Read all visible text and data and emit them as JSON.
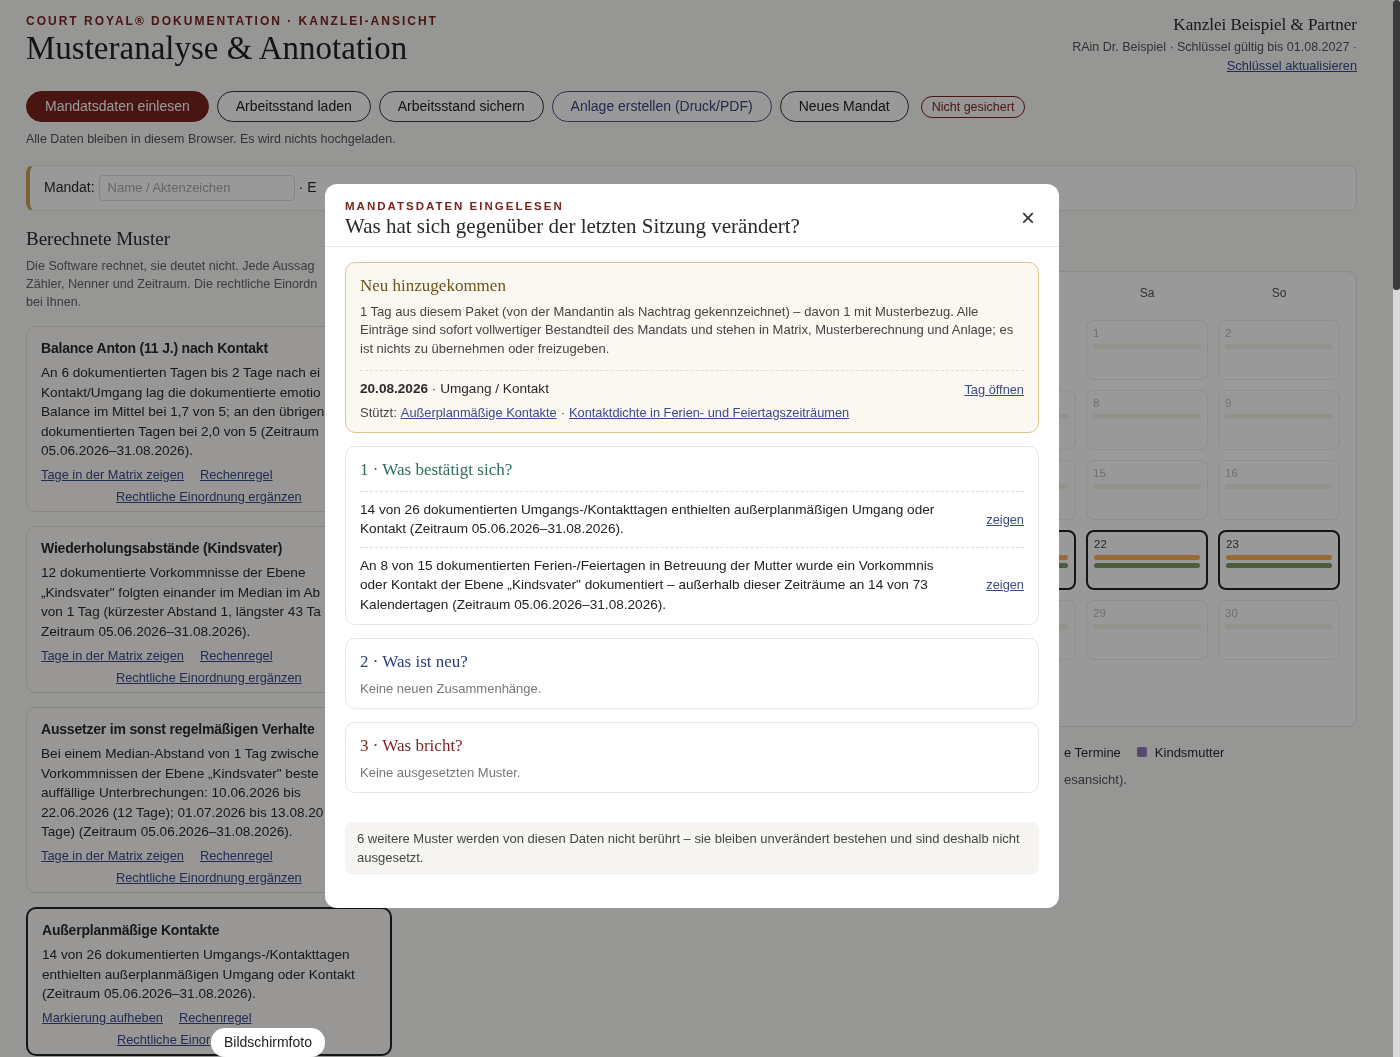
{
  "header": {
    "kicker": "COURT ROYAL® DOKUMENTATION · KANZLEI-ANSICHT",
    "title": "Musteranalyse & Annotation",
    "firm": "Kanzlei Beispiel & Partner",
    "license": "RAin Dr. Beispiel · Schlüssel gültig bis 01.08.2027 ·",
    "license_link": "Schlüssel aktualisieren"
  },
  "toolbar": {
    "buttons": [
      {
        "label": "Mandatsdaten einlesen",
        "kind": "primary"
      },
      {
        "label": "Arbeitsstand laden",
        "kind": "outline"
      },
      {
        "label": "Arbeitsstand sichern",
        "kind": "outline"
      },
      {
        "label": "Anlage erstellen (Druck/PDF)",
        "kind": "export"
      },
      {
        "label": "Neues Mandat",
        "kind": "outline"
      }
    ],
    "status": "Nicht gesichert",
    "note": "Alle Daten bleiben in diesem Browser. Es wird nichts hochgeladen."
  },
  "mandate_bar": {
    "label": "Mandat:",
    "placeholder": "Name / Aktenzeichen",
    "trailing": "· E"
  },
  "patterns": {
    "title": "Berechnete Muster",
    "intro_lines": [
      "Die Software rechnet, sie deutet nicht. Jede Aussag",
      "Zähler, Nenner und Zeitraum. Die rechtliche Einordn",
      "bei Ihnen."
    ],
    "cards": [
      {
        "title": "Balance Anton (11 J.) nach Kontakt",
        "selected": false,
        "lines": [
          "An 6 dokumentierten Tagen bis 2 Tage nach ei",
          "Kontakt/Umgang lag die dokumentierte emotio",
          "Balance im Mittel bei 1,7 von 5; an den übrigen",
          "dokumentierten Tagen bei 2,0 von 5 (Zeitraum",
          "05.06.2026–31.08.2026)."
        ],
        "links": [
          "Tage in der Matrix zeigen",
          "Rechenregel"
        ],
        "annotation_link": "Rechtliche Einordnung ergänzen"
      },
      {
        "title": "Wiederholungsabstände (Kindsvater)",
        "selected": false,
        "lines": [
          "12 dokumentierte Vorkommnisse der Ebene",
          "„Kindsvater\" folgten einander im Median im Ab",
          "von 1 Tag (kürzester Abstand 1, längster 43 Ta",
          "Zeitraum 05.06.2026–31.08.2026)."
        ],
        "links": [
          "Tage in der Matrix zeigen",
          "Rechenregel"
        ],
        "annotation_link": "Rechtliche Einordnung ergänzen"
      },
      {
        "title": "Aussetzer im sonst regelmäßigen Verhalte",
        "selected": false,
        "lines": [
          "Bei einem Median-Abstand von 1 Tag zwische",
          "Vorkommnissen der Ebene „Kindsvater\" beste",
          "auffällige Unterbrechungen: 10.06.2026 bis",
          "22.06.2026 (12 Tage); 01.07.2026 bis 13.08.20",
          "Tage) (Zeitraum 05.06.2026–31.08.2026)."
        ],
        "links": [
          "Tage in der Matrix zeigen",
          "Rechenregel"
        ],
        "annotation_link": "Rechtliche Einordnung ergänzen"
      },
      {
        "title": "Außerplanmäßige Kontakte",
        "selected": true,
        "lines": [
          "14 von 26 dokumentierten Umgangs-/Kontakttagen",
          "enthielten außerplanmäßigen Umgang oder Kontakt",
          "(Zeitraum 05.06.2026–31.08.2026)."
        ],
        "links": [
          "Markierung aufheben",
          "Rechenregel"
        ],
        "annotation_link": "Rechtliche Einor"
      }
    ]
  },
  "calendar": {
    "weekdays": [
      "Sa",
      "So"
    ],
    "rows": [
      {
        "cells": [
          null,
          {
            "day": "1",
            "highlighted": false,
            "bars": [
              {
                "color": "#8f938a"
              }
            ]
          },
          {
            "day": "2",
            "highlighted": false,
            "bars": [
              {
                "color": "#8f938a"
              }
            ]
          }
        ]
      },
      {
        "cells": [
          {
            "highlighted": false,
            "bars": [
              {
                "color": "#8f938a"
              }
            ]
          },
          {
            "day": "8",
            "highlighted": false,
            "bars": [
              {
                "color": "#8f938a"
              }
            ]
          },
          {
            "day": "9",
            "highlighted": false,
            "bars": [
              {
                "color": "#8f938a"
              }
            ]
          }
        ]
      },
      {
        "cells": [
          {
            "highlighted": false,
            "bars": [
              {
                "color": "#8f938a"
              }
            ]
          },
          {
            "day": "15",
            "highlighted": false,
            "bars": [
              {
                "color": "#8f938a"
              }
            ]
          },
          {
            "day": "16",
            "highlighted": false,
            "bars": [
              {
                "color": "#8f938a"
              }
            ]
          }
        ]
      },
      {
        "cells": [
          {
            "highlighted": true,
            "bars": [
              {
                "color": "#9a6a35"
              },
              {
                "color": "#4b5d3c"
              }
            ]
          },
          {
            "day": "22",
            "highlighted": true,
            "bars": [
              {
                "color": "#9a6a35"
              },
              {
                "color": "#4b5d3c"
              }
            ]
          },
          {
            "day": "23",
            "highlighted": true,
            "bars": [
              {
                "color": "#9a6a35"
              },
              {
                "color": "#4b5d3c"
              }
            ]
          }
        ]
      },
      {
        "cells": [
          {
            "highlighted": false,
            "bars": [
              {
                "color": "#8f938a"
              }
            ]
          },
          {
            "day": "29",
            "highlighted": false,
            "bars": [
              {
                "color": "#8f938a"
              }
            ]
          },
          {
            "day": "30",
            "highlighted": false,
            "bars": [
              {
                "color": "#8f938a"
              }
            ]
          }
        ]
      }
    ],
    "legend": [
      {
        "label": "e Termine"
      },
      {
        "label": "Kindsmutter",
        "color": "#574a70"
      }
    ],
    "note": "esansicht)."
  },
  "dialog": {
    "kicker": "MANDATSDATEN EINGELESEN",
    "close_label": "×",
    "title": "Was hat sich gegenüber der letzten Sitzung verändert?",
    "added": {
      "title": "Neu hinzugekommen",
      "text": "1 Tag aus diesem Paket (von der Mandantin als Nachtrag gekennzeichnet) – davon 1 mit Musterbezug. Alle Einträge sind sofort vollwertiger Bestandteil des Mandats und stehen in Matrix, Musterberechnung und Anlage; es ist nichts zu übernehmen oder freizugeben.",
      "entry": "**20.08.2026** · Umgang / Kontakt",
      "entry_link": "Tag öffnen",
      "supports_label": "Stützt:",
      "supports_separator": "·",
      "supports": [
        "Außerplanmäßige Kontakte",
        "Kontaktdichte in Ferien- und Feiertagszeiträumen"
      ]
    },
    "sections": [
      {
        "kind": "confirmed",
        "title": "1 · Was bestätigt sich?",
        "items": [
          {
            "text": "14 von 26 dokumentierten Umgangs-/Kontakttagen enthielten außerplanmäßigen Umgang oder Kontakt (Zeitraum 05.06.2026–31.08.2026).",
            "link": "zeigen"
          },
          {
            "text": "An 8 von 15 dokumentierten Ferien-/Feiertagen in Betreuung der Mutter wurde ein Vorkommnis oder Kontakt der Ebene „Kindsvater\" dokumentiert – außerhalb dieser Zeiträume an 14 von 73 Kalendertagen (Zeitraum 05.06.2026–31.08.2026).",
            "link": "zeigen"
          }
        ]
      },
      {
        "kind": "new",
        "title": "2 · Was ist neu?",
        "empty": "Keine neuen Zusammenhänge."
      },
      {
        "kind": "broken",
        "title": "3 · Was bricht?",
        "empty": "Keine ausgesetzten Muster."
      }
    ],
    "footer": "6 weitere Muster werden von diesen Daten nicht berührt – sie bleiben unverändert bestehen und sind deshalb nicht ausgesetzt."
  },
  "tooltip": "Bildschirmfoto"
}
